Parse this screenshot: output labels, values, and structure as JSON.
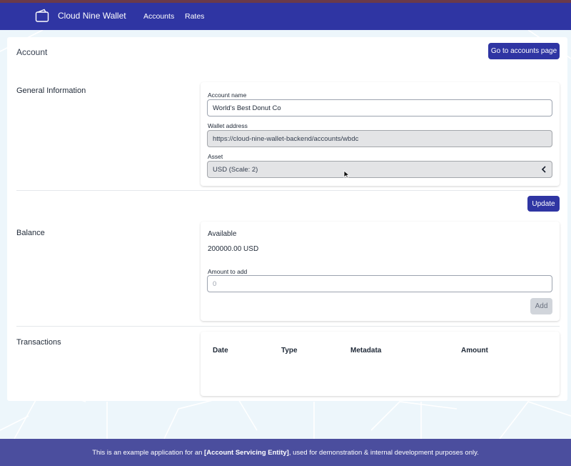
{
  "app": {
    "name": "Cloud Nine Wallet"
  },
  "nav": {
    "items": [
      {
        "label": "Accounts"
      },
      {
        "label": "Rates"
      }
    ]
  },
  "page": {
    "title": "Account",
    "go_button_label": "Go to accounts page"
  },
  "general": {
    "section_label": "General Information",
    "account_name_label": "Account name",
    "account_name_value": "World's Best Donut Co",
    "wallet_label": "Wallet address",
    "wallet_value": "https://cloud-nine-wallet-backend/accounts/wbdc",
    "asset_label": "Asset",
    "asset_value": "USD (Scale: 2)",
    "update_label": "Update"
  },
  "balance": {
    "section_label": "Balance",
    "available_label": "Available",
    "available_value": "200000.00 USD",
    "amount_label": "Amount to add",
    "amount_placeholder": "0",
    "add_label": "Add"
  },
  "transactions": {
    "section_label": "Transactions",
    "columns": [
      "Date",
      "Type",
      "Metadata",
      "Amount"
    ]
  },
  "footer": {
    "prefix": "This is an example application for an ",
    "emphasis": "[Account Servicing Entity]",
    "suffix": ", used for demonstration & internal development purposes only."
  },
  "colors": {
    "primary": "#2f35a3",
    "footer": "#4b4e9e",
    "background": "#edf6fb"
  }
}
